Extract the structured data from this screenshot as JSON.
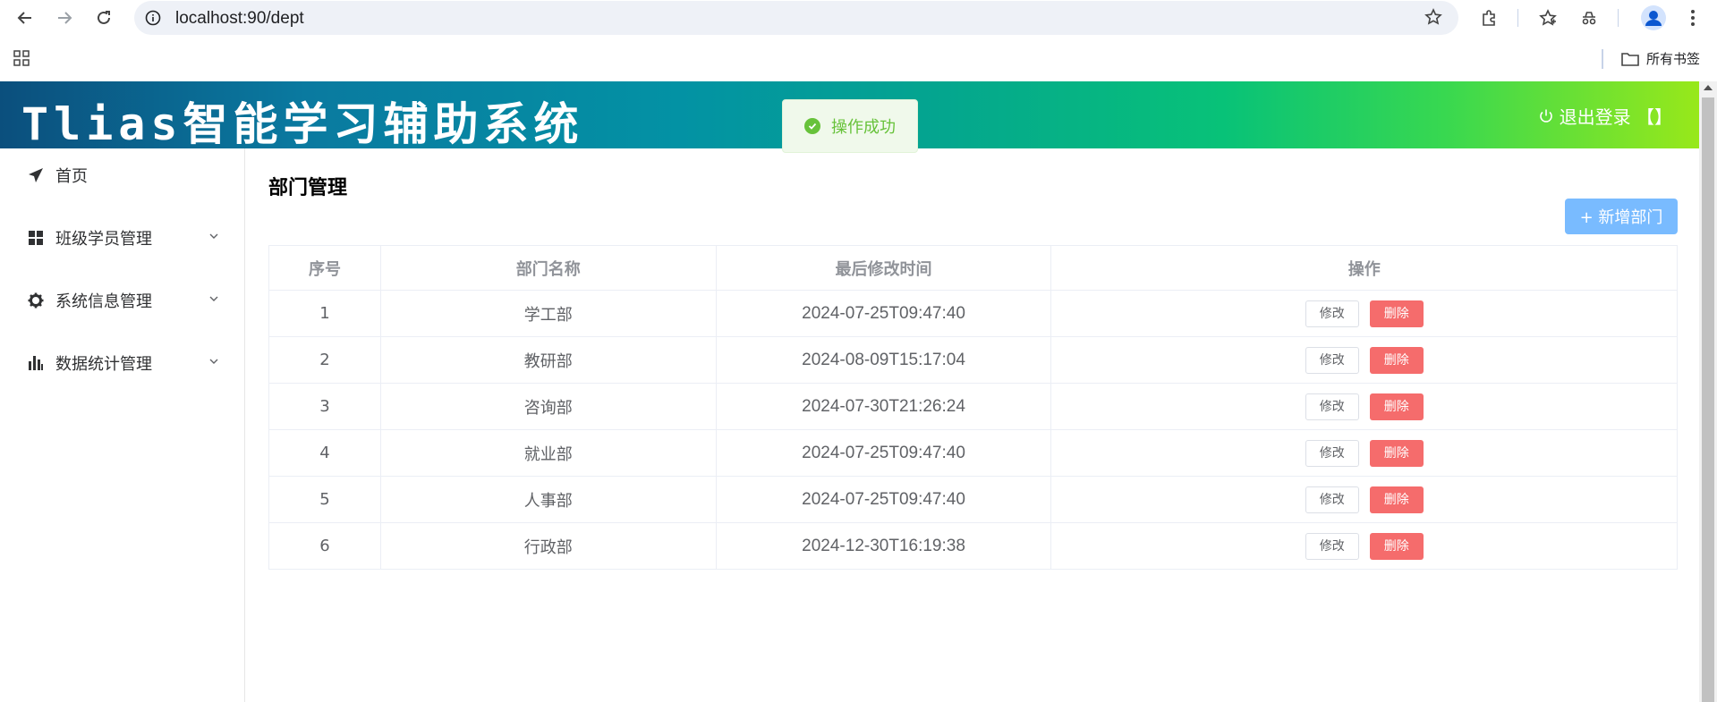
{
  "browser": {
    "url": "localhost:90/dept",
    "bookmarks_label": "所有书签"
  },
  "header": {
    "title": "Tlias智能学习辅助系统",
    "logout_label": "退出登录 【】"
  },
  "toast": {
    "message": "操作成功"
  },
  "sidebar": {
    "items": [
      {
        "label": "首页"
      },
      {
        "label": "班级学员管理"
      },
      {
        "label": "系统信息管理"
      },
      {
        "label": "数据统计管理"
      }
    ]
  },
  "main": {
    "title": "部门管理",
    "add_label": "+ 新增部门",
    "columns": [
      "序号",
      "部门名称",
      "最后修改时间",
      "操作"
    ],
    "edit_label": "修改",
    "delete_label": "删除",
    "rows": [
      {
        "index": "1",
        "name": "学工部",
        "time": "2024-07-25T09:47:40"
      },
      {
        "index": "2",
        "name": "教研部",
        "time": "2024-08-09T15:17:04"
      },
      {
        "index": "3",
        "name": "咨询部",
        "time": "2024-07-30T21:26:24"
      },
      {
        "index": "4",
        "name": "就业部",
        "time": "2024-07-25T09:47:40"
      },
      {
        "index": "5",
        "name": "人事部",
        "time": "2024-07-25T09:47:40"
      },
      {
        "index": "6",
        "name": "行政部",
        "time": "2024-12-30T16:19:38"
      }
    ]
  },
  "colors": {
    "toast_success": "#67c23a",
    "primary_light": "#79bbff",
    "danger": "#f56c6c"
  }
}
